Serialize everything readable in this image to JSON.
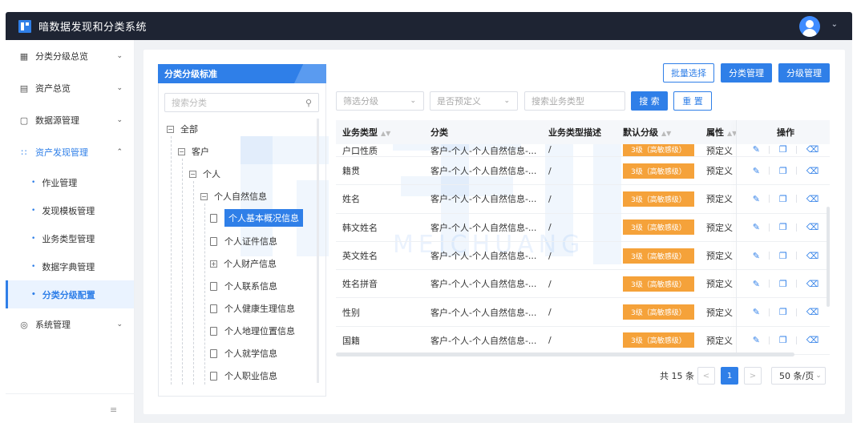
{
  "app": {
    "title": "暗数据发现和分类系统"
  },
  "sidebar": {
    "items": [
      {
        "label": "分类分级总览",
        "icon": "grid-icon",
        "chev": "⌄"
      },
      {
        "label": "资产总览",
        "icon": "server-icon",
        "chev": "⌄"
      },
      {
        "label": "数据源管理",
        "icon": "file-icon",
        "chev": "⌄"
      },
      {
        "label": "资产发现管理",
        "icon": "nodes-icon",
        "chev": "⌃"
      }
    ],
    "sub_items": [
      {
        "label": "作业管理"
      },
      {
        "label": "发现模板管理"
      },
      {
        "label": "业务类型管理"
      },
      {
        "label": "数据字典管理"
      },
      {
        "label": "分类分级配置"
      }
    ],
    "bottom_item": {
      "label": "系统管理",
      "icon": "settings-icon"
    },
    "collapse_icon": "≡"
  },
  "left_panel": {
    "title": "分类分级标准",
    "search_placeholder": "搜索分类",
    "tree": [
      {
        "label": "全部",
        "toggle": "−"
      },
      {
        "label": "客户",
        "toggle": "−"
      },
      {
        "label": "个人",
        "toggle": "−"
      },
      {
        "label": "个人自然信息",
        "toggle": "−"
      },
      {
        "label": "个人基本概况信息"
      },
      {
        "label": "个人证件信息"
      },
      {
        "label": "个人财产信息",
        "toggle": "+"
      },
      {
        "label": "个人联系信息"
      },
      {
        "label": "个人健康生理信息"
      },
      {
        "label": "个人地理位置信息"
      },
      {
        "label": "个人就学信息"
      },
      {
        "label": "个人职业信息"
      }
    ]
  },
  "toolbar": {
    "batch_select": "批量选择",
    "category_manage": "分类管理",
    "level_manage": "分级管理",
    "filter_level": "筛选分级",
    "filter_predefined": "是否预定义",
    "search_business_placeholder": "搜索业务类型",
    "search": "搜 索",
    "reset": "重 置"
  },
  "table": {
    "headers": [
      "业务类型",
      "分类",
      "业务类型描述",
      "默认分级",
      "属性",
      "操作"
    ],
    "rows": [
      {
        "type": "户口性质",
        "category": "客户-个人-个人自然信息-...",
        "desc": "/",
        "level": "3级（高敏感级）",
        "attr": "预定义"
      },
      {
        "type": "籍贯",
        "category": "客户-个人-个人自然信息-...",
        "desc": "/",
        "level": "3级（高敏感级）",
        "attr": "预定义"
      },
      {
        "type": "姓名",
        "category": "客户-个人-个人自然信息-...",
        "desc": "/",
        "level": "3级（高敏感级）",
        "attr": "预定义"
      },
      {
        "type": "韩文姓名",
        "category": "客户-个人-个人自然信息-...",
        "desc": "/",
        "level": "3级（高敏感级）",
        "attr": "预定义"
      },
      {
        "type": "英文姓名",
        "category": "客户-个人-个人自然信息-...",
        "desc": "/",
        "level": "3级（高敏感级）",
        "attr": "预定义"
      },
      {
        "type": "姓名拼音",
        "category": "客户-个人-个人自然信息-...",
        "desc": "/",
        "level": "3级（高敏感级）",
        "attr": "预定义"
      },
      {
        "type": "性别",
        "category": "客户-个人-个人自然信息-...",
        "desc": "/",
        "level": "3级（高敏感级）",
        "attr": "预定义"
      },
      {
        "type": "国籍",
        "category": "客户-个人-个人自然信息-...",
        "desc": "/",
        "level": "3级（高敏感级）",
        "attr": "预定义"
      }
    ]
  },
  "pagination": {
    "total": "共 15 条",
    "prev": "<",
    "current": "1",
    "next": ">",
    "page_size": "50 条/页"
  },
  "watermark": {
    "text": "MEICHUANG"
  },
  "colors": {
    "primary": "#2f7fe8",
    "badge": "#f5a23a",
    "topbar": "#1e2433"
  }
}
